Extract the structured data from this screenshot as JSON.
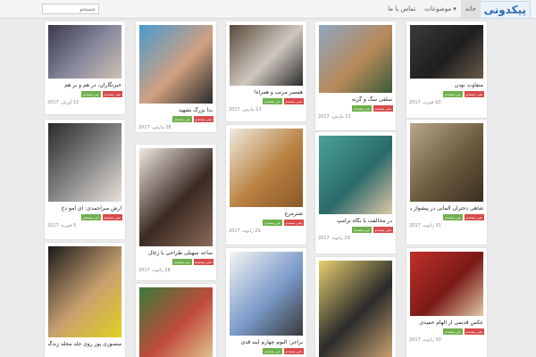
{
  "header": {
    "logo": "پیکدونی",
    "nav": [
      {
        "label": "خانه",
        "key": "home"
      },
      {
        "label": "موضوعات ▾",
        "key": "topics"
      },
      {
        "label": "تماس با ما",
        "key": "contact"
      }
    ],
    "search_placeholder": "جستجو"
  },
  "card_labels": {
    "dislike": "نمی پسندم",
    "like": "می پسندم"
  },
  "cards": [
    {
      "id": "c0",
      "title": "متفاوت بودن",
      "date": "10 فوریه، 2017",
      "colors": [
        "#3a3a3a",
        "#1e1e1e",
        "#6a5a4a"
      ]
    },
    {
      "id": "c1",
      "title": "شاهی دختران آلمانی در پیشواز بیشوا!!",
      "date": "31 ژانویه، 2017",
      "colors": [
        "#b8a78a",
        "#6b5a3e",
        "#3a2f22"
      ]
    },
    {
      "id": "c2",
      "title": "عکس قدیمی از الهام حمیدی",
      "date": "30 ژانویه، 2017",
      "colors": [
        "#c0302a",
        "#7a1a16",
        "#e0c8a8"
      ]
    },
    {
      "id": "c3",
      "title": "سلفی سگ و گربه",
      "date": "13 مارس، 2017",
      "colors": [
        "#8ea6c2",
        "#b88a5a",
        "#3a5a3a"
      ]
    },
    {
      "id": "c4",
      "title": "در مخالفت با نگاه ترامپ",
      "date": "29 ژانویه، 2017",
      "colors": [
        "#4aa09a",
        "#2a6a6a",
        "#e0c8a8"
      ]
    },
    {
      "id": "c5",
      "title": "",
      "date": "",
      "colors": [
        "#e8d070",
        "#2a2a2a",
        "#c8a070"
      ]
    },
    {
      "id": "c6",
      "title": "همسر مرتب و همراه!",
      "date": "13 مارس، 2017",
      "colors": [
        "#5a4a3a",
        "#d0c8c0",
        "#2a2a2a"
      ]
    },
    {
      "id": "c7",
      "title": "شترمرغ",
      "date": "29 ژانویه، 2017",
      "colors": [
        "#f0ebe0",
        "#b88040",
        "#8a5a2a"
      ]
    },
    {
      "id": "c8",
      "title": "براجر: آلبوم چهارم آینه قدی",
      "date": "",
      "colors": [
        "#f4f4f4",
        "#7a9ac8",
        "#3a3a3a"
      ]
    },
    {
      "id": "c9",
      "title": "بدأ بزرگ بشهید",
      "date": "28 مارس، 2017",
      "colors": [
        "#4a9ad0",
        "#d0a080",
        "#2a2a2a"
      ]
    },
    {
      "id": "c10",
      "title": "ساعد سهیلی طراحی با زغال",
      "date": "28 ژانویه، 2017",
      "colors": [
        "#f0e8e0",
        "#3a2a22",
        "#8a6a5a"
      ]
    },
    {
      "id": "c11",
      "title": "",
      "date": "",
      "colors": [
        "#3a7a3a",
        "#c04a3a",
        "#e0c090"
      ]
    },
    {
      "id": "c12",
      "title": "خبرنگاران، در هم و بر هم",
      "date": "12 آوریل، 2017",
      "colors": [
        "#3a3a4a",
        "#8a8aa0",
        "#d0c0b0"
      ]
    },
    {
      "id": "c13",
      "title": "آرش میراحمدی: ای امو دخ",
      "date": "5 فوریه، 2017",
      "colors": [
        "#2a2a2a",
        "#8a8a8a",
        "#e8e0d8"
      ]
    },
    {
      "id": "c14",
      "title": "منصوری پور روی جلد مجله زندگی",
      "date": "",
      "colors": [
        "#1a1a1a",
        "#c8a070",
        "#e0d020"
      ]
    }
  ]
}
